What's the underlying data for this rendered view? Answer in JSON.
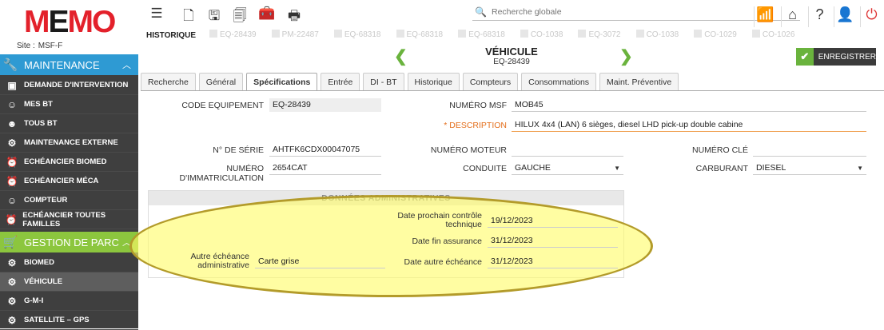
{
  "logo": {
    "m1": "M",
    "e": "E",
    "m2": "MO"
  },
  "site": {
    "label": "Site :",
    "value": "MSF-F"
  },
  "sidebar": {
    "maintenance": {
      "label": "MAINTENANCE",
      "items": [
        {
          "label": "DEMANDE D'INTERVENTION",
          "icon": "request-icon"
        },
        {
          "label": "MES BT",
          "icon": "worker-icon"
        },
        {
          "label": "TOUS BT",
          "icon": "workers-icon"
        },
        {
          "label": "MAINTENANCE EXTERNE",
          "icon": "gears-icon"
        },
        {
          "label": "ECHÉANCIER BIOMED",
          "icon": "clock-icon"
        },
        {
          "label": "ECHÉANCIER MÉCA",
          "icon": "clock-icon"
        },
        {
          "label": "COMPTEUR",
          "icon": "worker-icon"
        },
        {
          "label": "ECHÉANCIER TOUTES FAMILLES",
          "icon": "clock-icon"
        }
      ]
    },
    "parc": {
      "label": "GESTION DE PARC",
      "items": [
        {
          "label": "BIOMED",
          "icon": "gears-icon"
        },
        {
          "label": "VÉHICULE",
          "icon": "gears-icon"
        },
        {
          "label": "G-M-I",
          "icon": "gears-icon"
        },
        {
          "label": "SATELLITE – GPS",
          "icon": "gears-icon"
        }
      ]
    }
  },
  "search": {
    "placeholder": "Recherche globale"
  },
  "history": {
    "label": "HISTORIQUE",
    "chips": [
      "EQ-28439",
      "PM-22487",
      "EQ-68318",
      "EQ-68318",
      "EQ-68318",
      "CO-1038",
      "EQ-3072",
      "CO-1038",
      "CO-1029",
      "CO-1026"
    ]
  },
  "record": {
    "title": "VÉHICULE",
    "code": "EQ-28439",
    "save_label": "ENREGISTRER"
  },
  "tabs": [
    "Recherche",
    "Général",
    "Spécifications",
    "Entrée",
    "DI - BT",
    "Historique",
    "Compteurs",
    "Consommations",
    "Maint. Préventive"
  ],
  "form": {
    "code_equipement": {
      "label": "CODE EQUIPEMENT",
      "value": "EQ-28439"
    },
    "numero_msf": {
      "label": "NUMÉRO MSF",
      "value": "MOB45"
    },
    "description": {
      "label": "DESCRIPTION",
      "required": "* ",
      "value": "HILUX 4x4 (LAN) 6 sièges, diesel LHD pick-up double cabine"
    },
    "numero_serie": {
      "label": "N° DE SÉRIE",
      "value": "AHTFK6CDX00047075"
    },
    "numero_moteur": {
      "label": "NUMÉRO MOTEUR",
      "value": ""
    },
    "numero_cle": {
      "label": "NUMÉRO CLÉ",
      "value": ""
    },
    "immatriculation": {
      "label": "NUMÉRO D'IMMATRICULATION",
      "value": "2654CAT"
    },
    "conduite": {
      "label": "CONDUITE",
      "value": "GAUCHE"
    },
    "carburant": {
      "label": "CARBURANT",
      "value": "DIESEL"
    }
  },
  "admin": {
    "title": "DONNÉES ADMINISTRATIVES",
    "controle_label": "Date prochain contrôle technique",
    "controle_value": "19/12/2023",
    "assurance_label": "Date fin assurance",
    "assurance_value": "31/12/2023",
    "autre_echeance_label": "Date autre échéance",
    "autre_echeance_value": "31/12/2023",
    "autre_admin_label": "Autre échéance administrative",
    "autre_admin_value": "Carte grise"
  },
  "colors": {
    "maintenance": "#2e9ad3",
    "parc": "#8cc63e",
    "accent_green": "#6ab33d",
    "logo_red": "#e3212b"
  }
}
